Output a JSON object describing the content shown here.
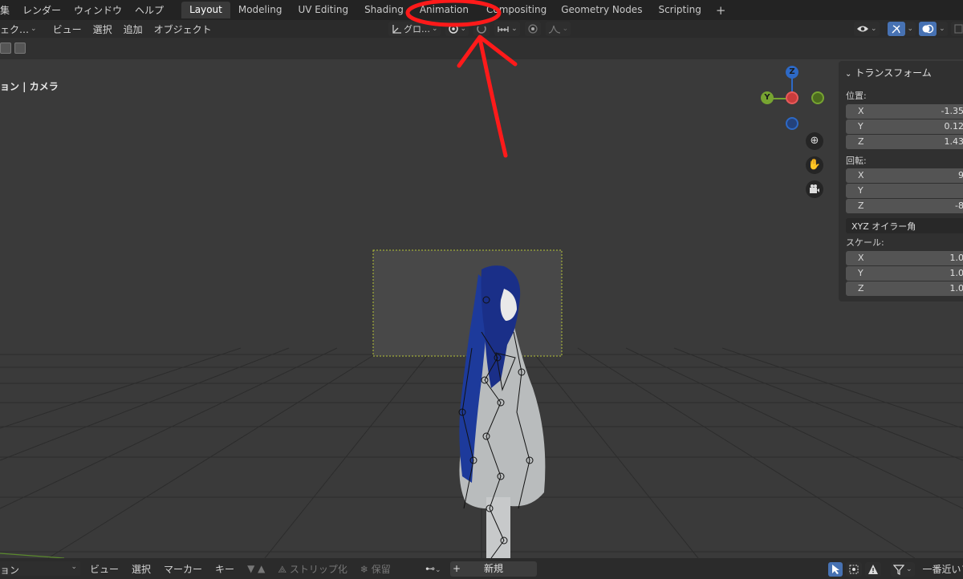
{
  "menubar": {
    "items": [
      "集",
      "レンダー",
      "ウィンドウ",
      "ヘルプ"
    ],
    "workspaces": [
      "Layout",
      "Modeling",
      "UV Editing",
      "Shading",
      "Animation",
      "Compositing",
      "Geometry Nodes",
      "Scripting"
    ],
    "active_workspace": "Layout",
    "add_symbol": "+"
  },
  "header": {
    "mode_label": "ェク…",
    "menus": [
      "ビュー",
      "選択",
      "追加",
      "オブジェクト"
    ],
    "orientation_label": "グロ…"
  },
  "viewport": {
    "view_label": "ョン | カメラ",
    "gizmo": {
      "x": "",
      "y": "Y",
      "z": "Z"
    }
  },
  "npanel": {
    "title": "トランスフォーム",
    "location_label": "位置:",
    "location": [
      {
        "axis": "X",
        "value": "-1.35"
      },
      {
        "axis": "Y",
        "value": "0.12"
      },
      {
        "axis": "Z",
        "value": "1.43"
      }
    ],
    "rotation_label": "回転:",
    "rotation": [
      {
        "axis": "X",
        "value": "9"
      },
      {
        "axis": "Y",
        "value": ""
      },
      {
        "axis": "Z",
        "value": "-8"
      }
    ],
    "rotation_mode": "XYZ オイラー角",
    "scale_label": "スケール:",
    "scale": [
      {
        "axis": "X",
        "value": "1.0"
      },
      {
        "axis": "Y",
        "value": "1.0"
      },
      {
        "axis": "Z",
        "value": "1.0"
      }
    ]
  },
  "footer": {
    "editor_label": "ョン",
    "menus": [
      "ビュー",
      "選択",
      "マーカー",
      "キー"
    ],
    "strip_label": "ストリップ化",
    "keep_label": "保留",
    "new_label": "新規",
    "snap_label": "一番近いフレ"
  },
  "colors": {
    "annotation": "#ff1a1a",
    "camera_frame": "#b6c437",
    "axis_x": "#c83c3c",
    "axis_y": "#77a431",
    "axis_z": "#2d69c6",
    "active_tab": "#3a3a3a",
    "blue_button": "#4772b3"
  },
  "icons": [
    "zoom-in-icon",
    "hand-pan-icon",
    "camera-icon",
    "eye-icon",
    "gizmo-icon",
    "overlay-icon",
    "snap-icon",
    "proportional-icon",
    "filter-icon",
    "warning-icon"
  ]
}
